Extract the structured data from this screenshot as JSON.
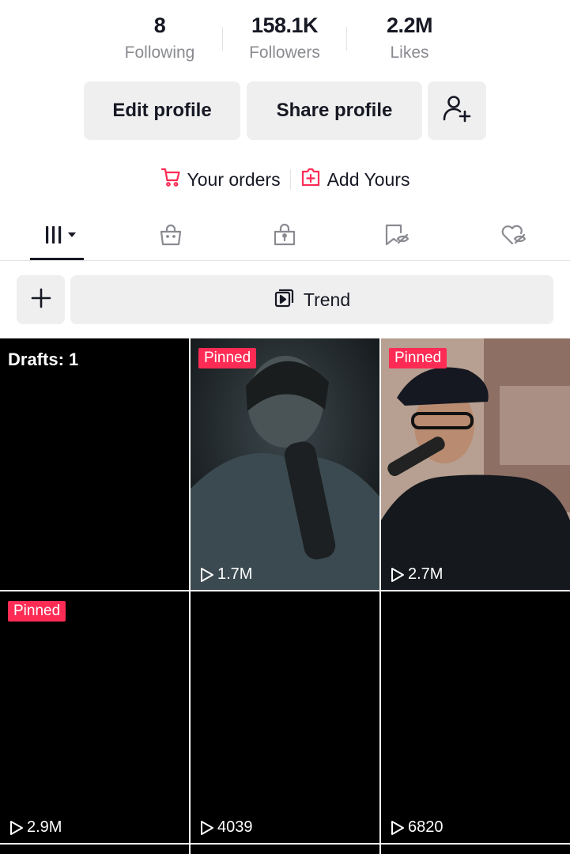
{
  "stats": {
    "following": {
      "value": "8",
      "label": "Following"
    },
    "followers": {
      "value": "158.1K",
      "label": "Followers"
    },
    "likes": {
      "value": "2.2M",
      "label": "Likes"
    }
  },
  "actions": {
    "edit_label": "Edit profile",
    "share_label": "Share profile",
    "add_friend_icon": "person-add-icon"
  },
  "shortcuts": {
    "orders_label": "Your orders",
    "add_yours_label": "Add Yours",
    "orders_icon": "cart-icon",
    "add_yours_icon": "plus-square-icon",
    "accent": "#fe2c55"
  },
  "tabs": [
    {
      "name": "videos",
      "icon": "grid-menu-icon",
      "active": true
    },
    {
      "name": "shop",
      "icon": "shopping-bag-icon",
      "active": false
    },
    {
      "name": "private",
      "icon": "lock-bag-icon",
      "active": false
    },
    {
      "name": "saved",
      "icon": "bookmark-hidden-icon",
      "active": false
    },
    {
      "name": "liked",
      "icon": "heart-hidden-icon",
      "active": false
    }
  ],
  "toolbar": {
    "add_icon": "plus-icon",
    "trend_label": "Trend",
    "trend_icon": "stacked-play-icon"
  },
  "videos": [
    {
      "drafts_label": "Drafts: 1"
    },
    {
      "badge": "Pinned",
      "views": "1.7M"
    },
    {
      "badge": "Pinned",
      "views": "2.7M"
    },
    {
      "badge": "Pinned",
      "views": "2.9M"
    },
    {
      "views": "4039"
    },
    {
      "views": "6820"
    }
  ]
}
